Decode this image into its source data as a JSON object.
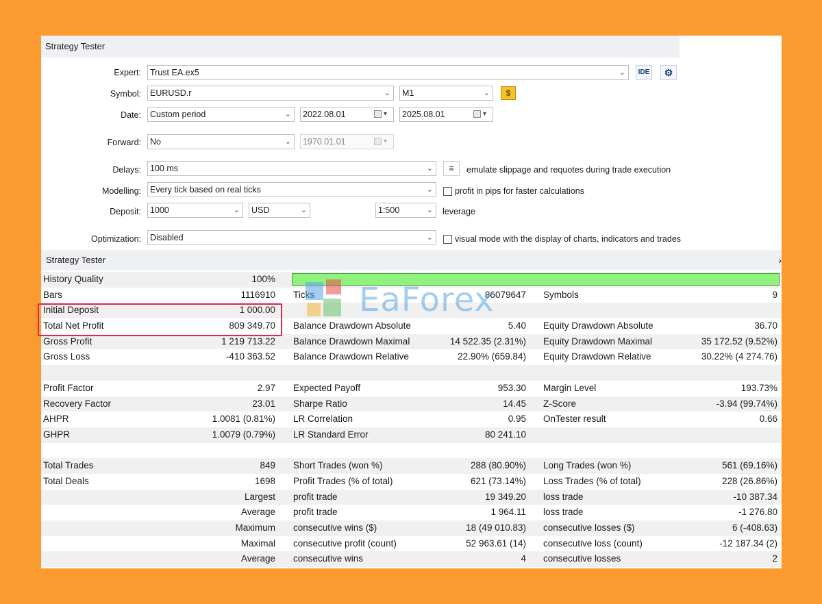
{
  "window": {
    "title": "Strategy Tester"
  },
  "settings": {
    "expert": {
      "label": "Expert:",
      "value": "Trust EA.ex5",
      "ide_label": "IDE"
    },
    "symbol": {
      "label": "Symbol:",
      "value": "EURUSD.r",
      "timeframe": "M1"
    },
    "date": {
      "label": "Date:",
      "mode": "Custom period",
      "from": "2022.08.01",
      "to": "2025.08.01"
    },
    "forward": {
      "label": "Forward:",
      "mode": "No",
      "date": "1970.01.01"
    },
    "delays": {
      "label": "Delays:",
      "value": "100 ms",
      "note": "emulate slippage and requotes during trade execution"
    },
    "modelling": {
      "label": "Modelling:",
      "value": "Every tick based on real ticks",
      "pips_checkbox": "profit in pips for faster calculations"
    },
    "deposit": {
      "label": "Deposit:",
      "amount": "1000",
      "currency": "USD",
      "leverage": "1:500",
      "leverage_label": "leverage"
    },
    "optimization": {
      "label": "Optimization:",
      "value": "Disabled",
      "visual_checkbox": "visual mode with the display of charts, indicators and trades"
    }
  },
  "results": {
    "title": "Strategy Tester",
    "history_quality": {
      "label": "History Quality",
      "value": "100%",
      "fill": 1.0
    },
    "rows": [
      {
        "l1": "Bars",
        "v1": "1116910",
        "l2": "Ticks",
        "v2": "86079647",
        "l3": "Symbols",
        "v3": "9"
      },
      {
        "l1": "Initial Deposit",
        "v1": "1 000.00",
        "l2": "",
        "v2": "",
        "l3": "",
        "v3": ""
      },
      {
        "l1": "Total Net Profit",
        "v1": "809 349.70",
        "l2": "Balance Drawdown Absolute",
        "v2": "5.40",
        "l3": "Equity Drawdown Absolute",
        "v3": "36.70"
      },
      {
        "l1": "Gross Profit",
        "v1": "1 219 713.22",
        "l2": "Balance Drawdown Maximal",
        "v2": "14 522.35 (2.31%)",
        "l3": "Equity Drawdown Maximal",
        "v3": "35 172.52 (9.52%)"
      },
      {
        "l1": "Gross Loss",
        "v1": "-410 363.52",
        "l2": "Balance Drawdown Relative",
        "v2": "22.90% (659.84)",
        "l3": "Equity Drawdown Relative",
        "v3": "30.22% (4 274.76)"
      },
      {
        "l1": "",
        "v1": "",
        "l2": "",
        "v2": "",
        "l3": "",
        "v3": ""
      },
      {
        "l1": "Profit Factor",
        "v1": "2.97",
        "l2": "Expected Payoff",
        "v2": "953.30",
        "l3": "Margin Level",
        "v3": "193.73%"
      },
      {
        "l1": "Recovery Factor",
        "v1": "23.01",
        "l2": "Sharpe Ratio",
        "v2": "14.45",
        "l3": "Z-Score",
        "v3": "-3.94 (99.74%)"
      },
      {
        "l1": "AHPR",
        "v1": "1.0081 (0.81%)",
        "l2": "LR Correlation",
        "v2": "0.95",
        "l3": "OnTester result",
        "v3": "0.66"
      },
      {
        "l1": "GHPR",
        "v1": "1.0079 (0.79%)",
        "l2": "LR Standard Error",
        "v2": "80 241.10",
        "l3": "",
        "v3": ""
      },
      {
        "l1": "",
        "v1": "",
        "l2": "",
        "v2": "",
        "l3": "",
        "v3": ""
      },
      {
        "l1": "Total Trades",
        "v1": "849",
        "l2": "Short Trades (won %)",
        "v2": "288 (80.90%)",
        "l3": "Long Trades (won %)",
        "v3": "561 (69.16%)"
      },
      {
        "l1": "Total Deals",
        "v1": "1698",
        "l2": "Profit Trades (% of total)",
        "v2": "621 (73.14%)",
        "l3": "Loss Trades (% of total)",
        "v3": "228 (26.86%)"
      },
      {
        "l1": "",
        "v1": "Largest",
        "l2": "profit trade",
        "v2": "19 349.20",
        "l3": "loss trade",
        "v3": "-10 387.34"
      },
      {
        "l1": "",
        "v1": "Average",
        "l2": "profit trade",
        "v2": "1 964.11",
        "l3": "loss trade",
        "v3": "-1 276.80"
      },
      {
        "l1": "",
        "v1": "Maximum",
        "l2": "consecutive wins ($)",
        "v2": "18 (49 010.83)",
        "l3": "consecutive losses ($)",
        "v3": "6 (-408.63)"
      },
      {
        "l1": "",
        "v1": "Maximal",
        "l2": "consecutive profit (count)",
        "v2": "52 963.61 (14)",
        "l3": "consecutive loss (count)",
        "v3": "-12 187.34 (2)"
      },
      {
        "l1": "",
        "v1": "Average",
        "l2": "consecutive wins",
        "v2": "4",
        "l3": "consecutive losses",
        "v3": "2"
      }
    ]
  },
  "watermark": {
    "text": "EaForex"
  },
  "colors": {
    "background": "#fb9a2e",
    "highlight": "#e0284a",
    "quality_bar": "#8ef27c"
  }
}
